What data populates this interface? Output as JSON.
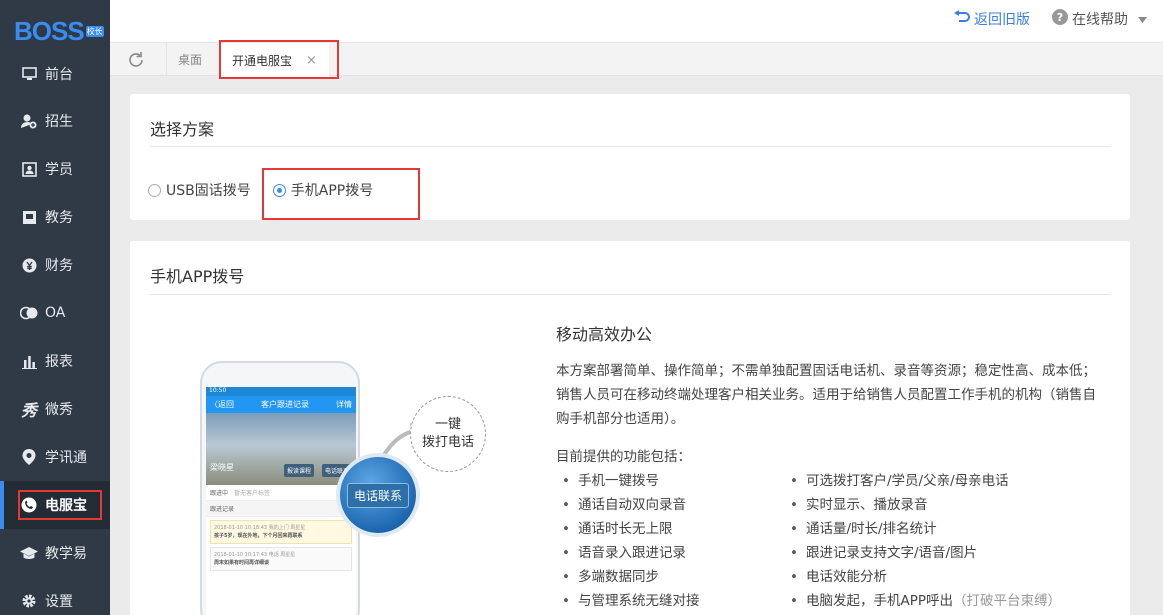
{
  "brand": {
    "logo_text": "BOSS",
    "logo_badge": "校长"
  },
  "sidebar": {
    "items": [
      {
        "label": "前台",
        "icon": "monitor-icon"
      },
      {
        "label": "招生",
        "icon": "user-add-icon"
      },
      {
        "label": "学员",
        "icon": "id-card-icon"
      },
      {
        "label": "教务",
        "icon": "book-icon"
      },
      {
        "label": "财务",
        "icon": "yen-icon"
      },
      {
        "label": "OA",
        "icon": "oa-icon"
      },
      {
        "label": "报表",
        "icon": "bar-chart-icon"
      },
      {
        "label": "微秀",
        "icon": "show-icon"
      },
      {
        "label": "学讯通",
        "icon": "location-pin-icon"
      },
      {
        "label": "电服宝",
        "icon": "phone-signal-icon",
        "active": true
      },
      {
        "label": "教学易",
        "icon": "graduation-cap-icon"
      },
      {
        "label": "设置",
        "icon": "gear-icon"
      }
    ]
  },
  "header": {
    "back_old": "返回旧版",
    "help": "在线帮助"
  },
  "tabs": {
    "desktop": "桌面",
    "current": "开通电服宝",
    "close": "×"
  },
  "plan": {
    "title": "选择方案",
    "options": [
      {
        "label": "USB固话拨号",
        "selected": false
      },
      {
        "label": "手机APP拨号",
        "selected": true
      }
    ]
  },
  "app_section": {
    "title": "手机APP拨号",
    "phone": {
      "time": "10:50",
      "back": "〈返回",
      "title": "客户跟进记录",
      "detail": "详情",
      "name": "梁晓星",
      "btn1": "报读课程",
      "btn2": "电话联系",
      "follow": "跟进中",
      "follow_hint": "暂无客户标签",
      "records": "跟进记录",
      "rec1_meta": "2018-01-10 10:18:43   我的上门   周星星",
      "rec1_text": "孩子5岁，现在外地，下个月回来再联系",
      "rec2_meta": "2018-01-10 10:17:43   电话   周星星",
      "rec2_text": "周末如果有时间再详细谈"
    },
    "dial_label_1": "一键",
    "dial_label_2": "拨打电话",
    "call_button": "电话联系",
    "heading": "移动高效办公",
    "description": "本方案部署简单、操作简单；不需单独配置固话电话机、录音等资源；稳定性高、成本低；销售人员可在移动终端处理客户相关业务。适用于给销售人员配置工作手机的机构（销售自购手机部分也适用）。",
    "features_head": "目前提供的功能包括：",
    "features_left": [
      "手机一键拨号",
      "通话自动双向录音",
      "通话时长无上限",
      "语音录入跟进记录",
      "多端数据同步",
      "与管理系统无缝对接"
    ],
    "features_right": [
      "可选拨打客户/学员/父亲/母亲电话",
      "实时显示、播放录音",
      "通话量/时长/排名统计",
      "跟进记录支持文字/语音/图片",
      "电话效能分析",
      "电脑发起，手机APP呼出"
    ],
    "features_right_last_note": "（打破平台束缚）"
  }
}
